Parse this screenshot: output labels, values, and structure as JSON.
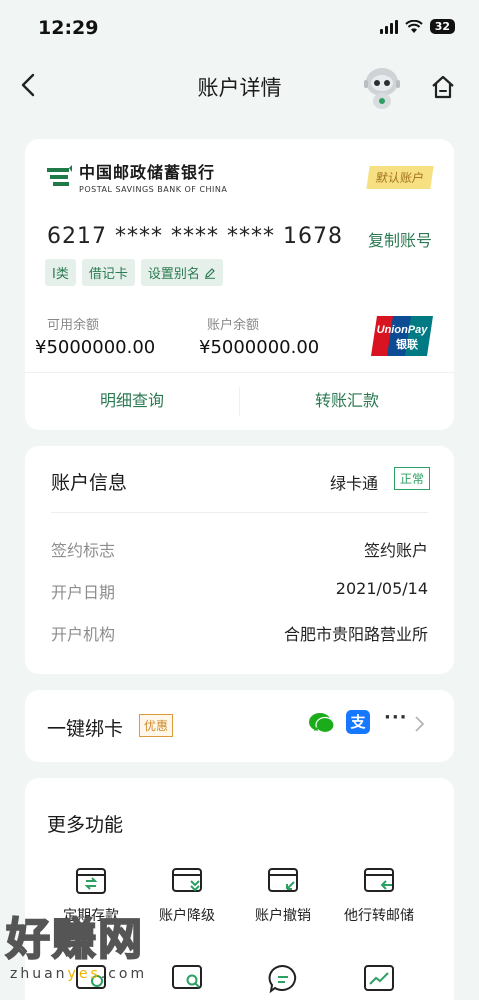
{
  "status_bar": {
    "time": "12:29",
    "battery": "32"
  },
  "nav": {
    "title": "账户详情"
  },
  "account_card": {
    "bank_name_cn": "中国邮政储蓄银行",
    "bank_name_en": "POSTAL SAVINGS BANK OF CHINA",
    "default_tag": "默认账户",
    "card_number": "6217 **** **** **** 1678",
    "copy_label": "复制账号",
    "tags": [
      "I类",
      "借记卡",
      "设置别名"
    ],
    "available_label": "可用余额",
    "available_value": "¥5000000.00",
    "balance_label": "账户余额",
    "balance_value": "¥5000000.00",
    "unionpay_en": "UnionPay",
    "unionpay_cn": "银联",
    "actions": [
      "明细查询",
      "转账汇款"
    ]
  },
  "account_info": {
    "title": "账户信息",
    "card_type": "绿卡通",
    "status": "正常",
    "rows": [
      {
        "label": "签约标志",
        "value": "签约账户"
      },
      {
        "label": "开户日期",
        "value": "2021/05/14"
      },
      {
        "label": "开户机构",
        "value": "合肥市贵阳路营业所"
      }
    ]
  },
  "bind": {
    "title": "一键绑卡",
    "promo": "优惠",
    "alipay_glyph": "支",
    "more": "···"
  },
  "more": {
    "title": "更多功能",
    "items": [
      {
        "label": "定期存款",
        "icon": "deposit-icon"
      },
      {
        "label": "账户降级",
        "icon": "downgrade-icon"
      },
      {
        "label": "账户撤销",
        "icon": "cancel-account-icon"
      },
      {
        "label": "他行转邮储",
        "icon": "transfer-in-icon"
      }
    ]
  },
  "watermark": {
    "text": "好赚网",
    "url_pre": "zhuan",
    "url_mid": "yes",
    "url_post": ".com"
  },
  "colors": {
    "accent": "#2c7a52",
    "background": "#f1f5f3",
    "default_tag_bg": "#f7e082",
    "promo": "#d08a2a"
  }
}
